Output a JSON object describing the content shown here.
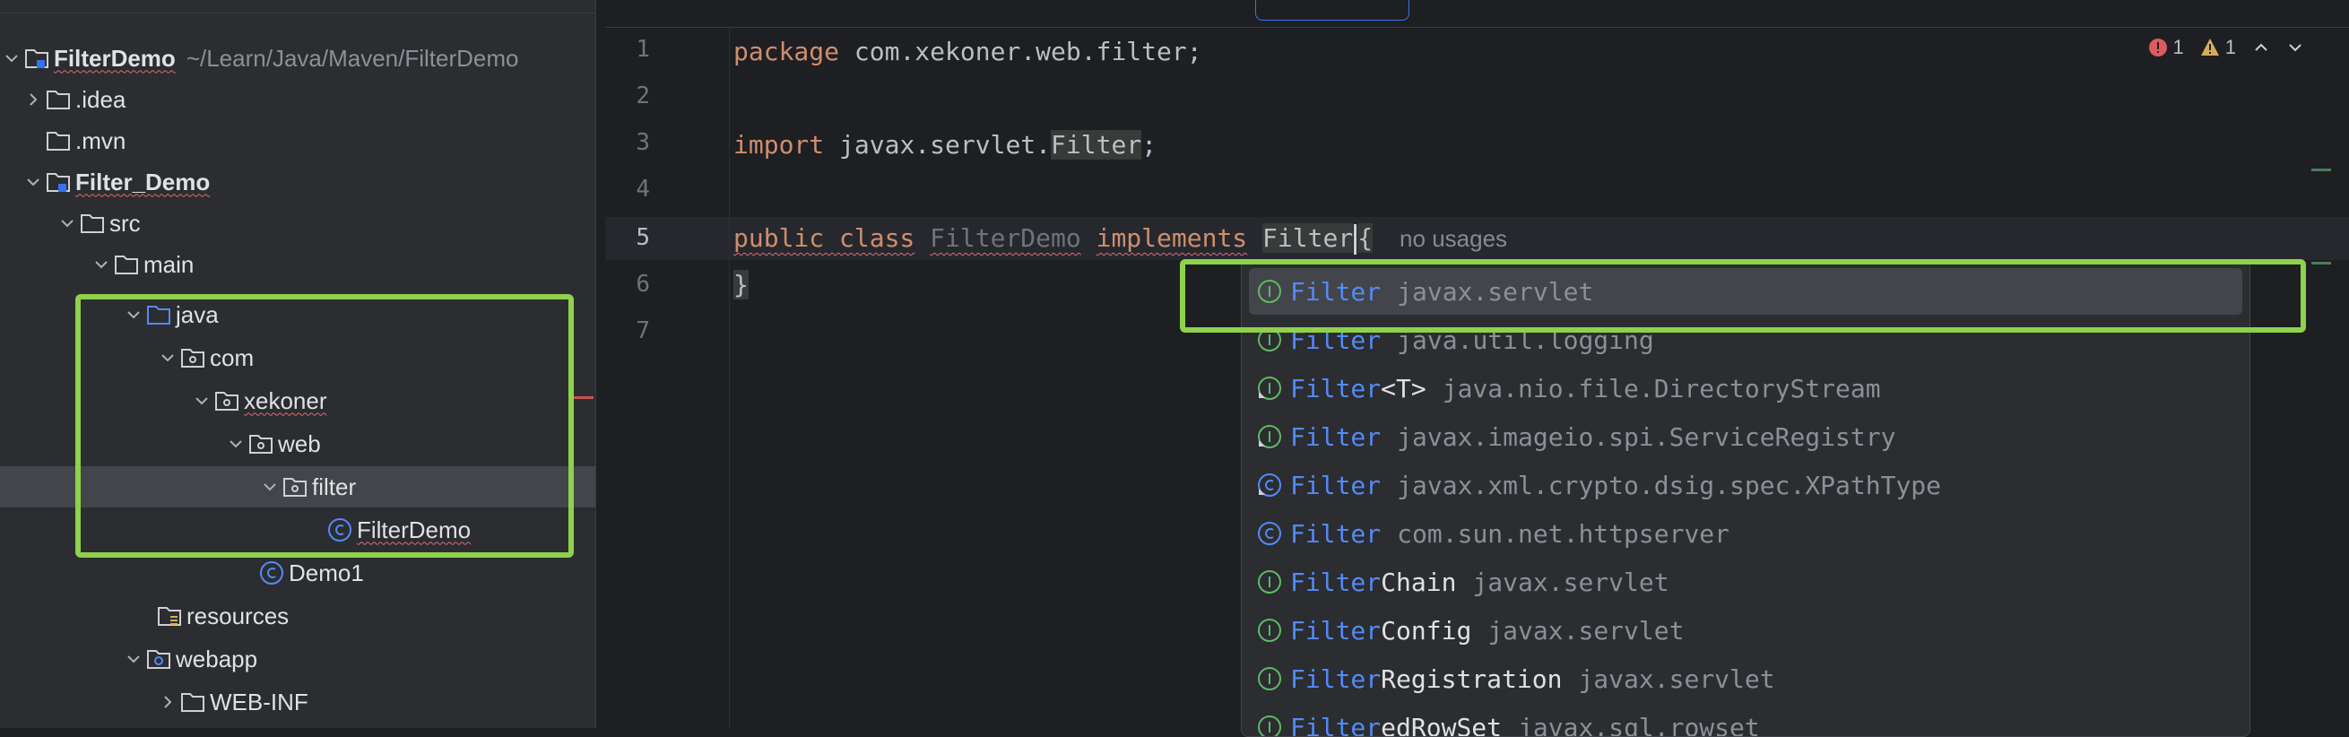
{
  "project": {
    "root_name": "FilterDemo",
    "root_path": "~/Learn/Java/Maven/FilterDemo",
    "items": [
      {
        "label": ".idea"
      },
      {
        "label": ".mvn"
      },
      {
        "label": "Filter_Demo"
      },
      {
        "label": "src"
      },
      {
        "label": "main"
      },
      {
        "label": "java"
      },
      {
        "label": "com"
      },
      {
        "label": "xekoner"
      },
      {
        "label": "web"
      },
      {
        "label": "filter"
      },
      {
        "label": "FilterDemo"
      },
      {
        "label": "Demo1"
      },
      {
        "label": "resources"
      },
      {
        "label": "webapp"
      },
      {
        "label": "WEB-INF"
      }
    ]
  },
  "editor": {
    "line_numbers": [
      "1",
      "2",
      "3",
      "4",
      "5",
      "6",
      "7"
    ],
    "code": {
      "l1_kw": "package",
      "l1_rest": " com.xekoner.web.filter;",
      "l3_kw": "import",
      "l3_pre": " javax.servlet.",
      "l3_sel": "Filter",
      "l3_end": ";",
      "l5_kw1": "public class",
      "l5_cls": "FilterDemo",
      "l5_kw2": "implements",
      "l5_typed": "Filter",
      "l5_brace": "{",
      "l5_hint": "no usages",
      "l6": "}"
    },
    "inspections": {
      "errors": "1",
      "warnings": "1"
    }
  },
  "completion": {
    "items": [
      {
        "match": "Filter",
        "rest": "",
        "pkg": "javax.servlet",
        "icon": "interface-icon"
      },
      {
        "match": "Filter",
        "rest": "",
        "pkg": "java.util.logging",
        "icon": "interface-icon"
      },
      {
        "match": "Filter",
        "rest": "<T>",
        "pkg": "java.nio.file.DirectoryStream",
        "icon": "interface-icon"
      },
      {
        "match": "Filter",
        "rest": "",
        "pkg": "javax.imageio.spi.ServiceRegistry",
        "icon": "interface-icon"
      },
      {
        "match": "Filter",
        "rest": "",
        "pkg": "javax.xml.crypto.dsig.spec.XPathType",
        "icon": "class-icon"
      },
      {
        "match": "Filter",
        "rest": "",
        "pkg": "com.sun.net.httpserver",
        "icon": "class-icon"
      },
      {
        "match": "Filter",
        "rest": "Chain",
        "pkg": "javax.servlet",
        "icon": "interface-icon"
      },
      {
        "match": "Filter",
        "rest": "Config",
        "pkg": "javax.servlet",
        "icon": "interface-icon"
      },
      {
        "match": "Filter",
        "rest": "Registration",
        "pkg": "javax.servlet",
        "icon": "interface-icon"
      },
      {
        "match": "Filter",
        "rest": "edRowSet",
        "pkg": "javax.sql.rowset",
        "icon": "interface-icon"
      }
    ]
  },
  "colors": {
    "highlight": "#8ed14a",
    "match": "#548af7",
    "keyword": "#cf8e6d"
  }
}
